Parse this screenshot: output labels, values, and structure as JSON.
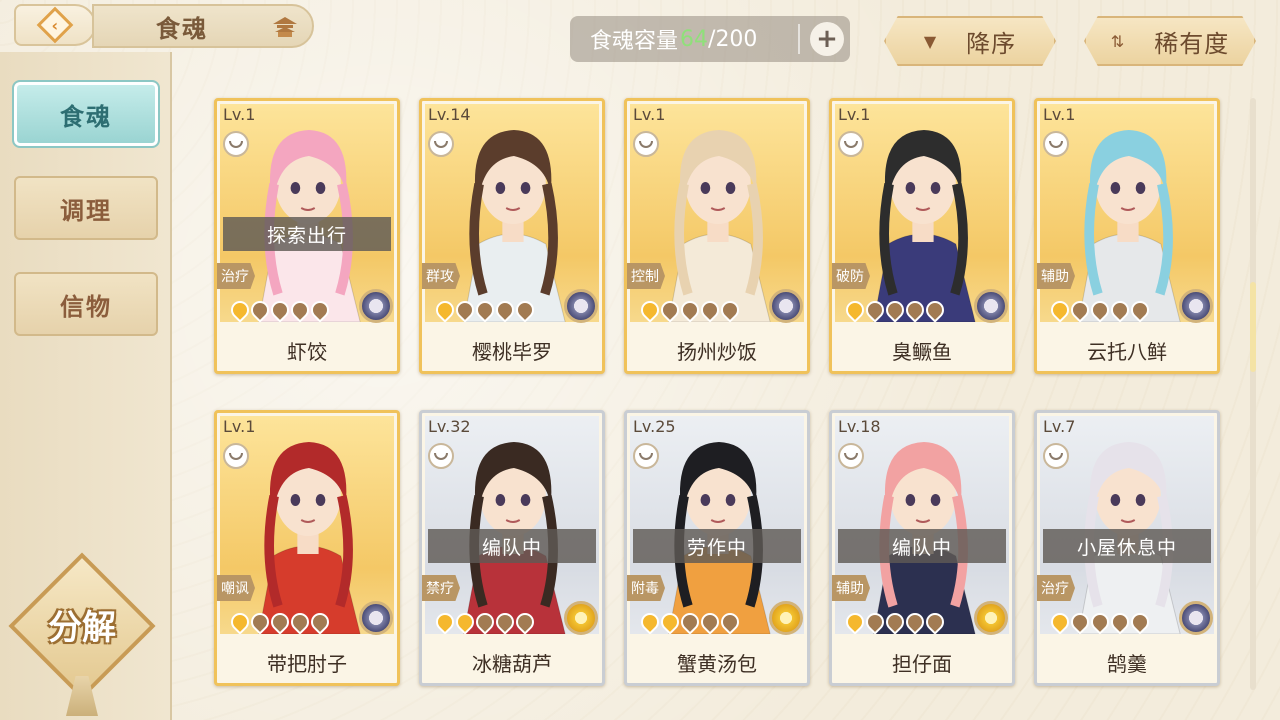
{
  "header": {
    "title": "食魂",
    "back_icon": "back-arrow-icon",
    "title_icon": "pagoda-icon"
  },
  "capacity": {
    "label": "食魂容量",
    "used": "64",
    "separator": "/",
    "max": "200",
    "add_icon": "plus-icon"
  },
  "sort": {
    "order_label": "降序",
    "rarity_label": "稀有度"
  },
  "sidebar": {
    "tabs": [
      {
        "label": "食魂",
        "active": true
      },
      {
        "label": "调理",
        "active": false
      },
      {
        "label": "信物",
        "active": false
      }
    ],
    "decompose_label": "分解"
  },
  "colors": {
    "gold_frame": "#f0c25a",
    "silver_frame": "#c9cdd3",
    "active_tab": "#9ad4d2",
    "capacity_used": "#8fe07a"
  },
  "cards": [
    {
      "name": "虾饺",
      "level": "Lv.1",
      "role": "治疗",
      "status": "探索出行",
      "stars": 1,
      "rarity": "gold",
      "element": "dark-flower",
      "hair": "#f4a6c0",
      "outfit": "#fbe6ea"
    },
    {
      "name": "樱桃毕罗",
      "level": "Lv.14",
      "role": "群攻",
      "status": "",
      "stars": 1,
      "rarity": "gold",
      "element": "dark-flower",
      "hair": "#5b3d2c",
      "outfit": "#e9eef0"
    },
    {
      "name": "扬州炒饭",
      "level": "Lv.1",
      "role": "控制",
      "status": "",
      "stars": 1,
      "rarity": "gold",
      "element": "dark-flower",
      "hair": "#e8d2b0",
      "outfit": "#f4ead8"
    },
    {
      "name": "臭鳜鱼",
      "level": "Lv.1",
      "role": "破防",
      "status": "",
      "stars": 1,
      "rarity": "gold",
      "element": "dark-flower",
      "hair": "#2d2d2d",
      "outfit": "#3a3b7a"
    },
    {
      "name": "云托八鲜",
      "level": "Lv.1",
      "role": "辅助",
      "status": "",
      "stars": 1,
      "rarity": "gold",
      "element": "dark-flower",
      "hair": "#8ad0e0",
      "outfit": "#e6e8ea"
    },
    {
      "name": "带把肘子",
      "level": "Lv.1",
      "role": "嘲讽",
      "status": "",
      "stars": 1,
      "rarity": "gold",
      "element": "dark-flower",
      "hair": "#b22a2a",
      "outfit": "#d63c2c"
    },
    {
      "name": "冰糖葫芦",
      "level": "Lv.32",
      "role": "禁疗",
      "status": "编队中",
      "stars": 2,
      "rarity": "gray",
      "element": "gold-flower",
      "hair": "#3a2a22",
      "outfit": "#b8323a"
    },
    {
      "name": "蟹黄汤包",
      "level": "Lv.25",
      "role": "附毒",
      "status": "劳作中",
      "stars": 2,
      "rarity": "gray",
      "element": "gold-flower",
      "hair": "#1e1e22",
      "outfit": "#f0a040"
    },
    {
      "name": "担仔面",
      "level": "Lv.18",
      "role": "辅助",
      "status": "编队中",
      "stars": 1,
      "rarity": "gray",
      "element": "gold-flower",
      "hair": "#f2a2a2",
      "outfit": "#2c3050"
    },
    {
      "name": "鹄羹",
      "level": "Lv.7",
      "role": "治疗",
      "status": "小屋休息中",
      "stars": 1,
      "rarity": "gray",
      "element": "dark-flower",
      "hair": "#e6e2ea",
      "outfit": "#eef0f2"
    }
  ]
}
